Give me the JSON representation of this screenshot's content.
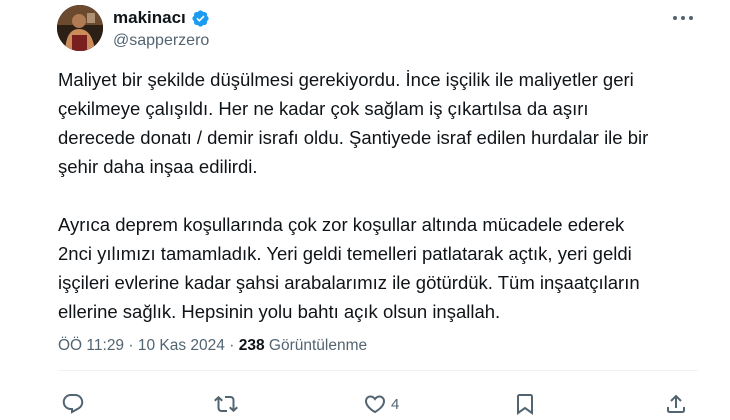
{
  "author": {
    "name": "makinacı",
    "handle": "@sapperzero"
  },
  "tweet": {
    "paragraphs": [
      [
        "Maliyet bir şekilde düşülmesi gerekiyordu. İnce işçilik ile maliyetler geri",
        "çekilmeye çalışıldı. Her ne kadar çok sağlam iş çıkartılsa da aşırı",
        "derecede donatı / demir israfı oldu. Şantiyede israf edilen hurdalar ile bir",
        "şehir daha inşaa edilirdi."
      ],
      [
        "Ayrıca deprem koşullarında çok zor koşullar altında mücadele ederek",
        "2nci yılımızı tamamladık. Yeri geldi temelleri patlatarak açtık, yeri geldi",
        "işçileri evlerine kadar şahsi arabalarımız ile götürdük. Tüm inşaatçıların",
        "ellerine sağlık. Hepsinin yolu bahtı açık olsun inşallah."
      ]
    ]
  },
  "meta": {
    "time": "ÖÖ 11:29",
    "date": "10 Kas 2024",
    "separator": "·",
    "views_count": "238",
    "views_label": "Görüntülenme"
  },
  "actions": {
    "reply_count": "",
    "retweet_count": "",
    "like_count": "4",
    "bookmark_count": ""
  },
  "colors": {
    "verified_badge": "#1d9bf0",
    "secondary_text": "#536471",
    "primary_text": "#0f1419"
  },
  "icons": [
    "verified-badge-icon",
    "more-icon",
    "reply-icon",
    "retweet-icon",
    "like-icon",
    "bookmark-icon",
    "share-icon"
  ]
}
